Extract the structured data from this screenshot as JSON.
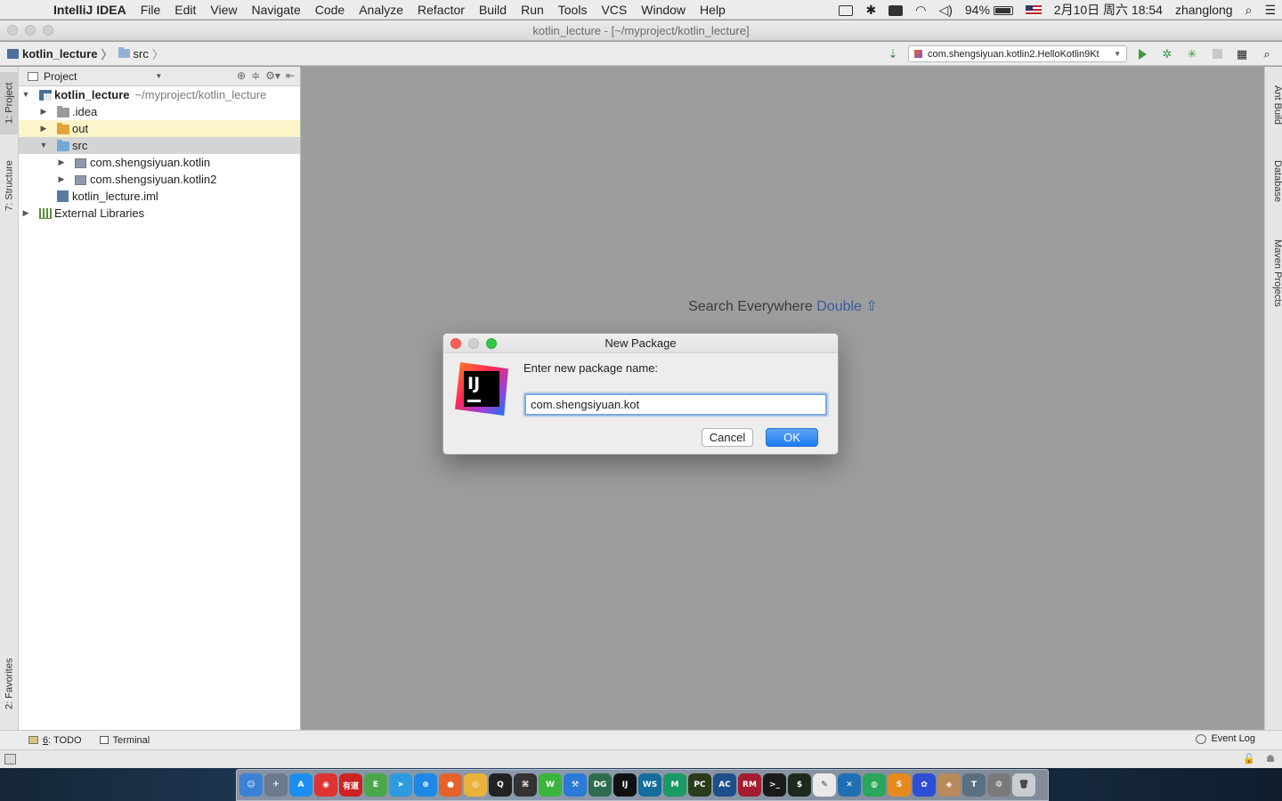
{
  "menubar": {
    "apple_glyph": "",
    "app_name": "IntelliJ IDEA",
    "items": [
      "File",
      "Edit",
      "View",
      "Navigate",
      "Code",
      "Analyze",
      "Refactor",
      "Build",
      "Run",
      "Tools",
      "VCS",
      "Window",
      "Help"
    ],
    "battery_percent": "94%",
    "datetime": "2月10日 周六 18:54",
    "user": "zhanglong"
  },
  "window": {
    "title": "kotlin_lecture - [~/myproject/kotlin_lecture]"
  },
  "navbar": {
    "crumbs": [
      "kotlin_lecture",
      "src"
    ],
    "run_config": "com.shengsiyuan.kotlin2.HelloKotlin9Kt"
  },
  "project_panel": {
    "title": "Project",
    "tree": [
      {
        "label": "kotlin_lecture",
        "path": "~/myproject/kotlin_lecture"
      },
      {
        "label": ".idea"
      },
      {
        "label": "out"
      },
      {
        "label": "src"
      },
      {
        "label": "com.shengsiyuan.kotlin"
      },
      {
        "label": "com.shengsiyuan.kotlin2"
      },
      {
        "label": "kotlin_lecture.iml"
      },
      {
        "label": "External Libraries"
      }
    ]
  },
  "side_tabs": {
    "left": [
      "1: Project",
      "7: Structure",
      "2: Favorites"
    ],
    "right": [
      "Ant Build",
      "Database",
      "Maven Projects"
    ]
  },
  "editor": {
    "hint_text": "Search Everywhere",
    "hint_key": "Double ⇧"
  },
  "dialog": {
    "title": "New Package",
    "prompt": "Enter new package name:",
    "input_value": "com.shengsiyuan.kot",
    "cancel_label": "Cancel",
    "ok_label": "OK",
    "logo_text": "IJ"
  },
  "bottom_tools": {
    "todo_num": "6",
    "todo_label": ": TODO",
    "terminal_label": "Terminal",
    "event_log_label": "Event Log"
  },
  "dock": {
    "apps": [
      {
        "name": "finder",
        "color": "#3b82d6",
        "glyph": "☺"
      },
      {
        "name": "launchpad",
        "color": "#6b7a8c",
        "glyph": "✈"
      },
      {
        "name": "app-store",
        "color": "#1b8ef2",
        "glyph": "A"
      },
      {
        "name": "netease-music",
        "color": "#d33",
        "glyph": "◉"
      },
      {
        "name": "youdao",
        "color": "#c22",
        "glyph": "有道"
      },
      {
        "name": "evernote",
        "color": "#4aa84a",
        "glyph": "E"
      },
      {
        "name": "telegram",
        "color": "#2d9be0",
        "glyph": "➤"
      },
      {
        "name": "safari",
        "color": "#1e88e5",
        "glyph": "⊕"
      },
      {
        "name": "firefox",
        "color": "#e5622a",
        "glyph": "●"
      },
      {
        "name": "chrome",
        "color": "#e9b23a",
        "glyph": "◎"
      },
      {
        "name": "qq",
        "color": "#222",
        "glyph": "Q"
      },
      {
        "name": "github",
        "color": "#333",
        "glyph": "⌘"
      },
      {
        "name": "wechat",
        "color": "#3bb53b",
        "glyph": "W"
      },
      {
        "name": "xcode",
        "color": "#2b7ad6",
        "glyph": "⚒"
      },
      {
        "name": "datagrip",
        "color": "#2f6c4f",
        "glyph": "DG"
      },
      {
        "name": "intellij",
        "color": "#111",
        "glyph": "IJ"
      },
      {
        "name": "webstorm",
        "color": "#146d9c",
        "glyph": "WS"
      },
      {
        "name": "clion",
        "color": "#1a9a64",
        "glyph": "M"
      },
      {
        "name": "pycharm",
        "color": "#2b3c1a",
        "glyph": "PC"
      },
      {
        "name": "appcode",
        "color": "#1e4f8a",
        "glyph": "AC"
      },
      {
        "name": "rubymine",
        "color": "#a41c2f",
        "glyph": "RM"
      },
      {
        "name": "terminal",
        "color": "#1a1a1a",
        "glyph": ">_"
      },
      {
        "name": "iterm",
        "color": "#1c2a1c",
        "glyph": "$"
      },
      {
        "name": "textedit",
        "color": "#e9e9e9",
        "glyph": "✎"
      },
      {
        "name": "visual-studio-code",
        "color": "#1f6fb5",
        "glyph": "✕"
      },
      {
        "name": "browser",
        "color": "#2aa65b",
        "glyph": "◍"
      },
      {
        "name": "sublime-text",
        "color": "#e68a1f",
        "glyph": "S"
      },
      {
        "name": "baidu",
        "color": "#2c4fd6",
        "glyph": "✿"
      },
      {
        "name": "preview",
        "color": "#b98a5c",
        "glyph": "◈"
      },
      {
        "name": "instruments",
        "color": "#5a6f80",
        "glyph": "T"
      },
      {
        "name": "system-preferences",
        "color": "#7a7a7a",
        "glyph": "⚙"
      },
      {
        "name": "trash",
        "color": "#c9cdd2",
        "glyph": "🗑"
      }
    ]
  }
}
